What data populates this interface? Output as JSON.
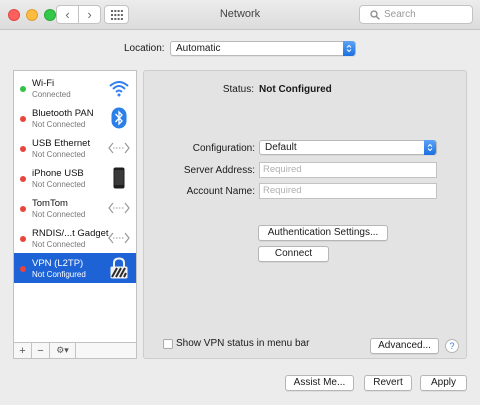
{
  "window": {
    "title": "Network"
  },
  "titlebar": {
    "back_glyph": "‹",
    "forward_glyph": "›",
    "search_placeholder": "Search"
  },
  "location": {
    "label": "Location:",
    "value": "Automatic"
  },
  "services": [
    {
      "name": "Wi-Fi",
      "status": "Connected",
      "dot_color": "#33c148",
      "icon": "wifi-icon"
    },
    {
      "name": "Bluetooth PAN",
      "status": "Not Connected",
      "dot_color": "#e9443b",
      "icon": "bluetooth-icon"
    },
    {
      "name": "USB Ethernet",
      "status": "Not Connected",
      "dot_color": "#e9443b",
      "icon": "ethernet-arrows-icon"
    },
    {
      "name": "iPhone USB",
      "status": "Not Connected",
      "dot_color": "#e9443b",
      "icon": "iphone-icon"
    },
    {
      "name": "TomTom",
      "status": "Not Connected",
      "dot_color": "#e9443b",
      "icon": "ethernet-arrows-icon"
    },
    {
      "name": "RNDIS/...t Gadget",
      "status": "Not Connected",
      "dot_color": "#e9443b",
      "icon": "ethernet-arrows-icon"
    },
    {
      "name": "VPN (L2TP)",
      "status": "Not Configured",
      "dot_color": "#e9443b",
      "icon": "vpn-lock-icon",
      "selected": true
    }
  ],
  "sidebar_footer": {
    "add": "+",
    "remove": "−",
    "gear": "⚙▾"
  },
  "detail": {
    "status_label": "Status:",
    "status_value": "Not Configured",
    "configuration_label": "Configuration:",
    "configuration_value": "Default",
    "server_label": "Server Address:",
    "server_placeholder": "Required",
    "account_label": "Account Name:",
    "account_placeholder": "Required",
    "auth_button": "Authentication Settings...",
    "connect_button": "Connect",
    "show_vpn_label": "Show VPN status in menu bar",
    "advanced_button": "Advanced...",
    "help_glyph": "?"
  },
  "footer": {
    "assist": "Assist Me...",
    "revert": "Revert",
    "apply": "Apply"
  },
  "colors": {
    "selection": "#1d63d6",
    "accent": "#3a7be0"
  }
}
